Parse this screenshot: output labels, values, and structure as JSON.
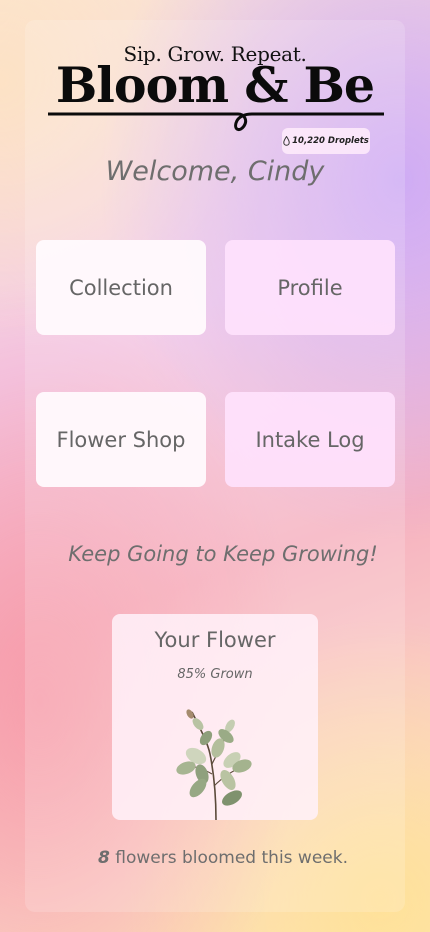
{
  "header": {
    "tagline": "Sip. Grow. Repeat.",
    "brand": "Bloom & Be"
  },
  "droplets": {
    "icon": "water-drop-icon",
    "value": "10,220 Droplets"
  },
  "welcome": "Welcome, Cindy",
  "menu": {
    "collection": "Collection",
    "profile": "Profile",
    "flower_shop": "Flower Shop",
    "intake_log": "Intake Log"
  },
  "motivation": "Keep Going to Keep Growing!",
  "flower": {
    "title": "Your Flower",
    "growth": "85% Grown",
    "growth_fraction": 0.85,
    "icon": "eucalyptus-sprig-icon"
  },
  "weekly": {
    "count": "8",
    "text": " flowers bloomed this week."
  },
  "colors": {
    "text_gray": "#6e6e6e",
    "tile_light": "#fffafd",
    "tile_pink": "#ffe2fd",
    "logo_black": "#0b0b0b"
  }
}
